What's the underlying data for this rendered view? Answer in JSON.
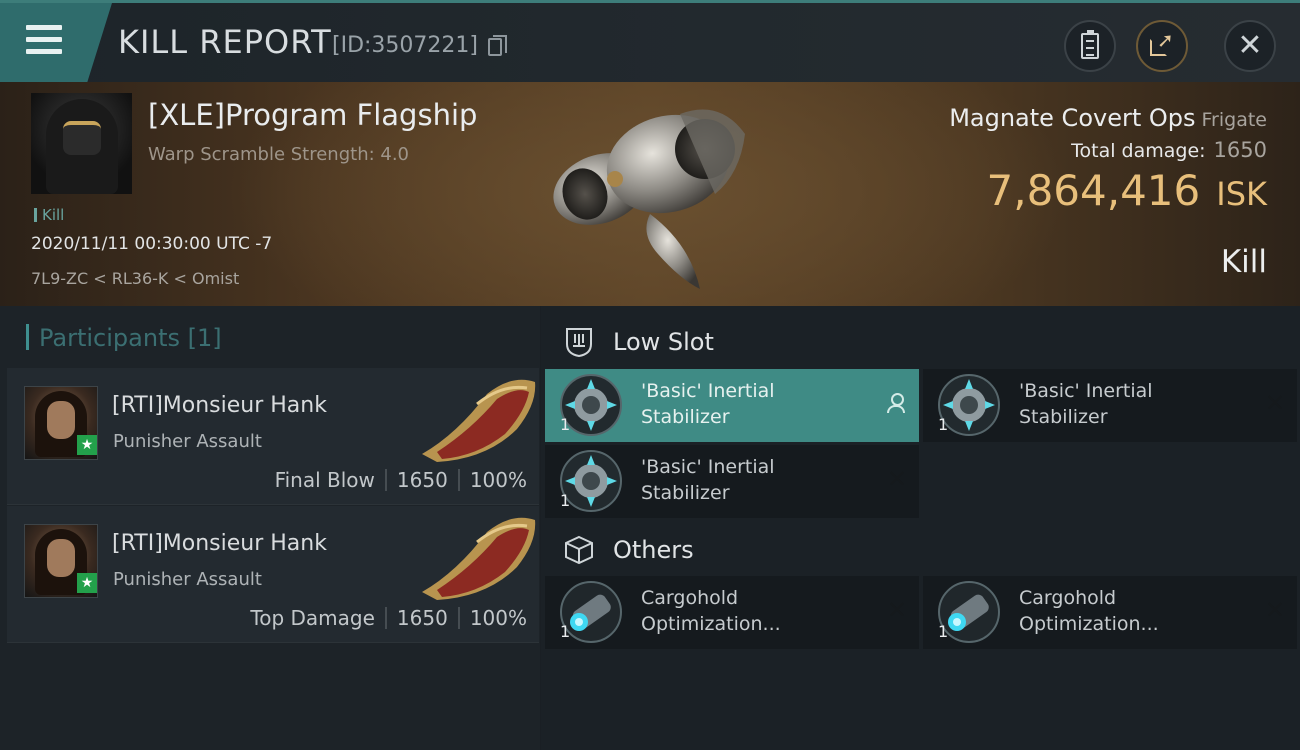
{
  "header": {
    "title": "KILL REPORT",
    "report_id": "[ID:3507221]",
    "icons": [
      "menu-icon",
      "copy-icon",
      "clipboard-icon",
      "share-icon",
      "close-icon"
    ]
  },
  "victim": {
    "name": "[XLE]Program Flagship",
    "warp_scramble": "Warp Scramble Strength: 4.0",
    "tag": "Kill",
    "datetime": "2020/11/11 00:30:00 UTC -7",
    "location": "7L9-ZC < RL36-K < Omist",
    "ship_name": "Magnate Covert Ops",
    "ship_class": "Frigate",
    "total_damage_label": "Total damage:",
    "total_damage": "1650",
    "isk_value": "7,864,416",
    "isk_unit": "ISK",
    "result": "Kill"
  },
  "participants": {
    "header": "Participants [1]",
    "rows": [
      {
        "name": "[RTI]Monsieur Hank",
        "ship": "Punisher Assault",
        "role": "Final Blow",
        "damage": "1650",
        "percent": "100%"
      },
      {
        "name": "[RTI]Monsieur Hank",
        "ship": "Punisher Assault",
        "role": "Top Damage",
        "damage": "1650",
        "percent": "100%"
      }
    ]
  },
  "fittings": {
    "low_slot_title": "Low Slot",
    "others_title": "Others",
    "low_slot": [
      {
        "line1": "'Basic' Inertial",
        "line2": "Stabilizer",
        "qty": "1"
      },
      {
        "line1": "'Basic' Inertial",
        "line2": "Stabilizer",
        "qty": "1"
      },
      {
        "line1": "'Basic' Inertial",
        "line2": "Stabilizer",
        "qty": "1"
      }
    ],
    "others": [
      {
        "line1": "Cargohold",
        "line2": "Optimization...",
        "qty": "1"
      },
      {
        "line1": "Cargohold",
        "line2": "Optimization...",
        "qty": "1"
      }
    ]
  },
  "colors": {
    "accent_teal": "#3f8b85",
    "isk_gold": "#e8bf7b",
    "badge_green": "#23a04b"
  }
}
